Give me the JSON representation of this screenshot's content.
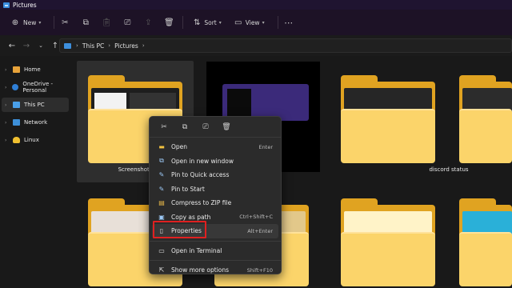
{
  "window": {
    "title": "Pictures"
  },
  "toolbar": {
    "new_label": "New",
    "sort_label": "Sort",
    "view_label": "View"
  },
  "address": {
    "crumbs": [
      "This PC",
      "Pictures"
    ]
  },
  "sidebar": {
    "items": [
      {
        "label": "Home",
        "icon": "home-icon"
      },
      {
        "label": "OneDrive - Personal",
        "icon": "cloud-icon"
      },
      {
        "label": "This PC",
        "icon": "pc-icon",
        "selected": true
      },
      {
        "label": "Network",
        "icon": "network-icon"
      },
      {
        "label": "Linux",
        "icon": "linux-icon"
      }
    ]
  },
  "folders": [
    {
      "label": "Screenshots"
    },
    {
      "label": ""
    },
    {
      "label": ""
    },
    {
      "label": "discord status"
    }
  ],
  "context_menu": {
    "items": [
      {
        "label": "Open",
        "shortcut": "Enter",
        "icon": "folder-open-icon"
      },
      {
        "label": "Open in new window",
        "shortcut": "",
        "icon": "new-window-icon"
      },
      {
        "label": "Pin to Quick access",
        "shortcut": "",
        "icon": "pin-icon"
      },
      {
        "label": "Pin to Start",
        "shortcut": "",
        "icon": "pin-icon"
      },
      {
        "label": "Compress to ZIP file",
        "shortcut": "",
        "icon": "zip-icon"
      },
      {
        "label": "Copy as path",
        "shortcut": "Ctrl+Shift+C",
        "icon": "path-icon"
      },
      {
        "label": "Properties",
        "shortcut": "Alt+Enter",
        "icon": "properties-icon"
      },
      {
        "label": "Open in Terminal",
        "shortcut": "",
        "icon": "terminal-icon"
      },
      {
        "label": "Show more options",
        "shortcut": "Shift+F10",
        "icon": "more-options-icon"
      }
    ]
  },
  "colors": {
    "highlight_box": "#e02020",
    "folder": "#fbd46a",
    "accent": "#3b8fe0"
  }
}
